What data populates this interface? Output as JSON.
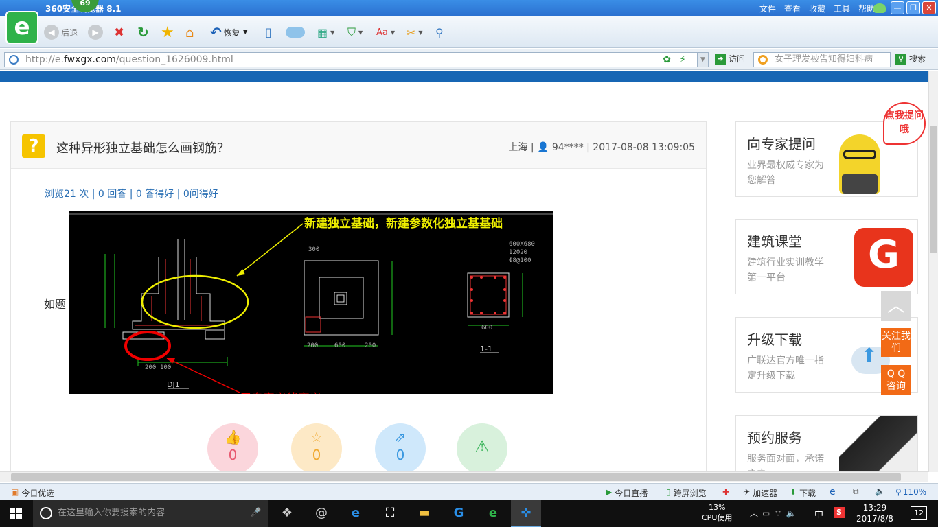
{
  "browser": {
    "title": "360安全浏览器 8.1",
    "badge": "69",
    "menu": [
      "文件",
      "查看",
      "收藏",
      "工具",
      "帮助"
    ],
    "toolbar": {
      "back": "后退",
      "restore": "恢复"
    },
    "url_prefix": "http://e.",
    "url_domain": "fwxgx.com",
    "url_path": "/question_1626009.html",
    "visit": "访问",
    "search_placeholder": "女子理发被告知得妇科病",
    "search_btn": "搜索"
  },
  "question": {
    "title": "这种异形独立基础怎么画钢筋？",
    "meta": "上海 | 👤 94**** | 2017-08-08 13:09:05",
    "stats": "浏览21 次 | 0 回答 | 0 答得好 | 0问得好",
    "body": "如题",
    "annotation_top": "新建独立基础，新建参数化独立基基础",
    "annotation_bottom": "用自定义线定义",
    "cad_labels": {
      "dj1": "DJ1",
      "section": "1-1",
      "spec1": "600X680",
      "spec2": "12Φ20",
      "spec3": "Φ8@100",
      "dim200": "200",
      "dim600": "600",
      "dim300": "300",
      "dim100": "100"
    }
  },
  "actions": [
    {
      "name": "like",
      "count": "0",
      "color": "#fbd6dc",
      "fg": "#e85a71",
      "icon": "👍"
    },
    {
      "name": "star",
      "count": "0",
      "color": "#fde9c6",
      "fg": "#f0a930",
      "icon": "☆"
    },
    {
      "name": "share",
      "count": "0",
      "color": "#cfe8fb",
      "fg": "#3a98e0",
      "icon": "⇗"
    },
    {
      "name": "report",
      "count": "",
      "color": "#d8f1dc",
      "fg": "#3ab45a",
      "icon": "⚠"
    }
  ],
  "sidebar": [
    {
      "title": "向专家提问",
      "desc": "业界最权威专家为您解答"
    },
    {
      "title": "建筑课堂",
      "desc": "建筑行业实训教学第一平台"
    },
    {
      "title": "升级下载",
      "desc": "广联达官方唯一指定升级下载"
    },
    {
      "title": "预约服务",
      "desc": "服务面对面，承诺之之"
    }
  ],
  "bubble": "点我提问哦",
  "float": {
    "follow": "关注我们",
    "qq": "Q Q 咨询"
  },
  "statusbar": {
    "left": "今日优选",
    "live": "今日直播",
    "screen": "跨屏浏览",
    "accel": "加速器",
    "download": "下载",
    "zoom": "110%"
  },
  "taskbar": {
    "search": "在这里输入你要搜索的内容",
    "cpu_pct": "13%",
    "cpu_label": "CPU使用",
    "ime": "中",
    "time": "13:29",
    "date": "2017/8/8",
    "notif": "12"
  }
}
